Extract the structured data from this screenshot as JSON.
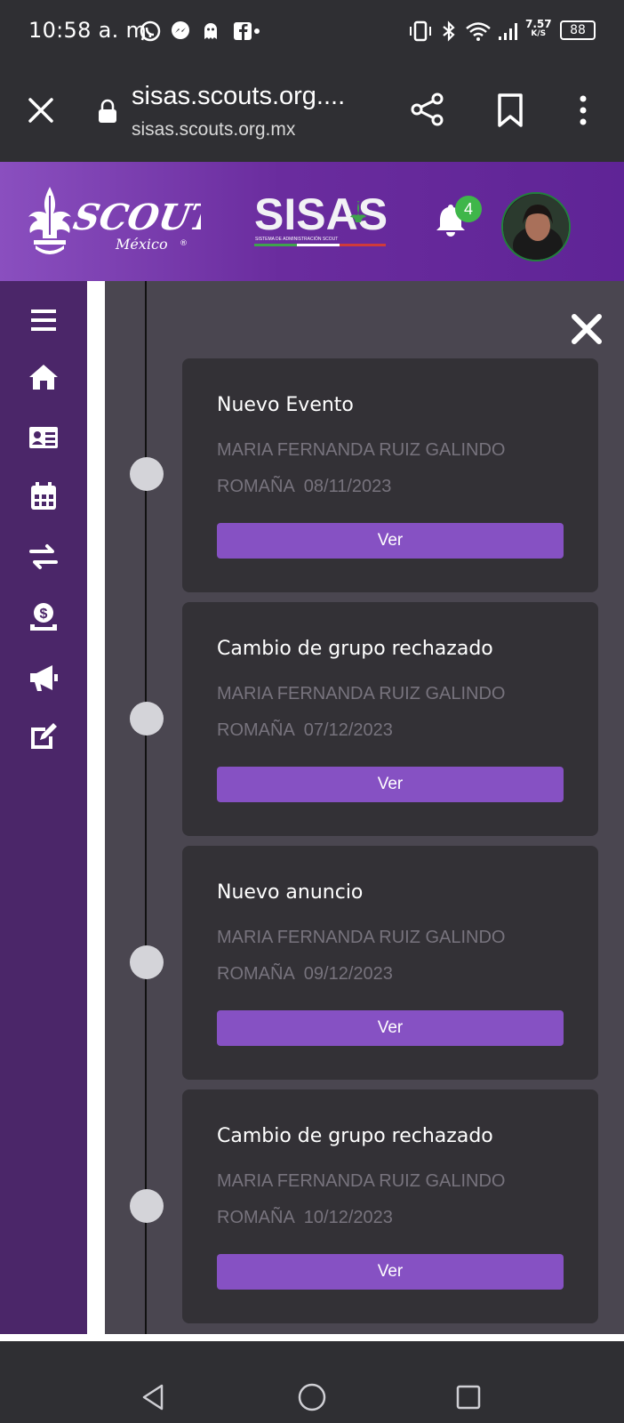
{
  "status_bar": {
    "time": "10:58 a. m.",
    "net_speed_value": "7.57",
    "net_speed_unit": "K/S",
    "battery": "88"
  },
  "browser": {
    "url_title": "sisas.scouts.org....",
    "url_sub": "sisas.scouts.org.mx"
  },
  "header": {
    "notification_count": "4"
  },
  "sidebar": {
    "icons": [
      "menu-icon",
      "home-icon",
      "id-card-icon",
      "calendar-icon",
      "transfer-icon",
      "payment-icon",
      "megaphone-icon",
      "edit-icon"
    ]
  },
  "cards": [
    {
      "title": "Nuevo Evento",
      "name": "MARIA FERNANDA RUIZ GALINDO",
      "place": "ROMAÑA",
      "date": "08/11/2023",
      "button": "Ver"
    },
    {
      "title": "Cambio de grupo rechazado",
      "name": "MARIA FERNANDA RUIZ GALINDO",
      "place": "ROMAÑA",
      "date": "07/12/2023",
      "button": "Ver"
    },
    {
      "title": "Nuevo anuncio",
      "name": "MARIA FERNANDA RUIZ GALINDO",
      "place": "ROMAÑA",
      "date": "09/12/2023",
      "button": "Ver"
    },
    {
      "title": "Cambio de grupo rechazado",
      "name": "MARIA FERNANDA RUIZ GALINDO",
      "place": "ROMAÑA",
      "date": "10/12/2023",
      "button": "Ver"
    }
  ],
  "colors": {
    "header_purple": "#6a2c9e",
    "sidebar_purple": "#4b2669",
    "button_purple": "#8651c3",
    "card_bg": "#333136",
    "badge_green": "#3fb64a"
  }
}
